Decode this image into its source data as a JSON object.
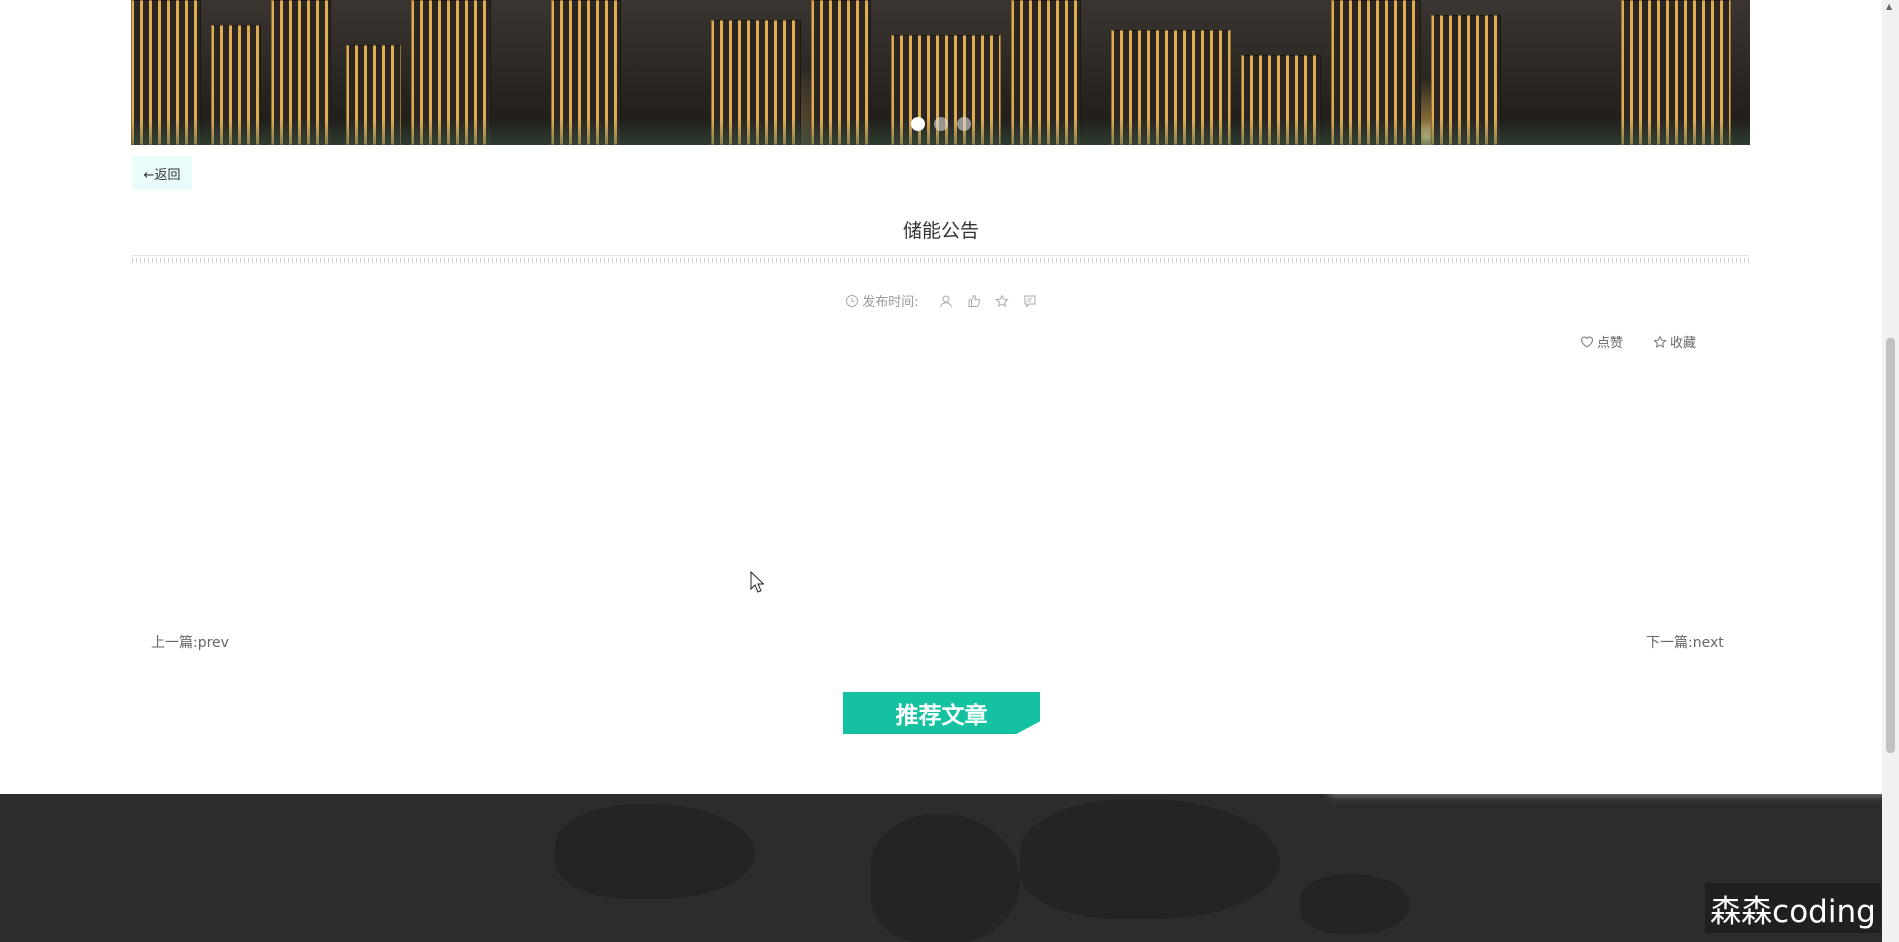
{
  "banner": {
    "slide_count": 3,
    "active_slide": 0
  },
  "back_button": {
    "label": "←返回"
  },
  "article": {
    "title": "储能公告",
    "published_label": "发布时间:",
    "icons": [
      "user-icon",
      "thumb-up-icon",
      "star-icon",
      "comment-icon"
    ]
  },
  "actions": {
    "like_label": "点赞",
    "favorite_label": "收藏"
  },
  "pagination": {
    "prev_label": "上一篇:prev",
    "next_label": "下一篇:next"
  },
  "recommend": {
    "label": "推荐文章"
  },
  "watermark": {
    "text": "森森coding"
  },
  "colors": {
    "accent": "#14c1a0",
    "back_button_bg": "#e9fbfb",
    "footer_bg": "#2c2c2c"
  }
}
